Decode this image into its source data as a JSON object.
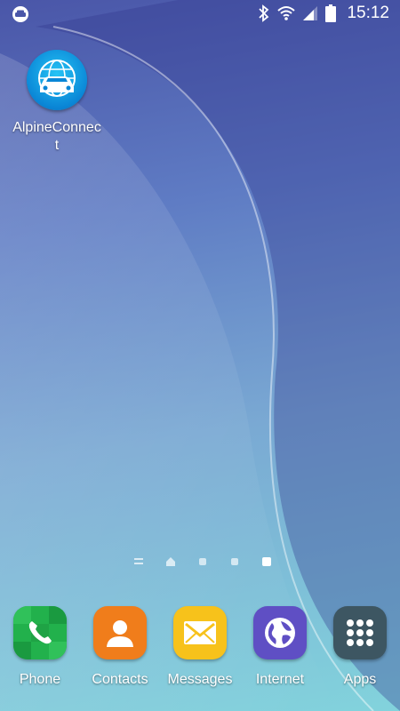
{
  "status_bar": {
    "time": "15:12",
    "icons": [
      "car-mode-icon",
      "bluetooth-icon",
      "wifi-icon",
      "signal-icon",
      "battery-icon"
    ]
  },
  "home": {
    "apps": [
      {
        "label": "AlpineConnect",
        "icon": "car-globe-icon"
      }
    ]
  },
  "page_indicator": {
    "pages": [
      "menu",
      "home",
      "page",
      "page",
      "page"
    ],
    "active_index": 4
  },
  "dock": {
    "items": [
      {
        "label": "Phone",
        "icon": "phone-icon",
        "color": "#22b14c"
      },
      {
        "label": "Contacts",
        "icon": "contact-icon",
        "color": "#f07d1b"
      },
      {
        "label": "Messages",
        "icon": "envelope-icon",
        "color": "#f7c21b"
      },
      {
        "label": "Internet",
        "icon": "globe-icon",
        "color": "#5f4fc4"
      },
      {
        "label": "Apps",
        "icon": "apps-grid-icon",
        "color": "#3d5662"
      }
    ]
  }
}
